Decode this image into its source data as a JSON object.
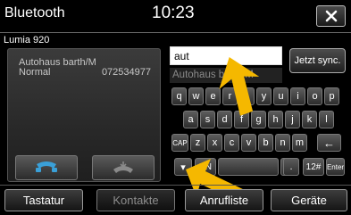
{
  "header": {
    "title": "Bluetooth",
    "time": "10:23",
    "close_icon": "close-icon"
  },
  "device": {
    "name": "Lumia 920"
  },
  "contact": {
    "name": "Autohaus barth/M",
    "type": "Normal",
    "number": "072534977"
  },
  "call_buttons": [
    {
      "icon": "phone-call-icon",
      "color": "#3aa0d8"
    },
    {
      "icon": "phone-hangup-icon",
      "color": "#8a8a8a"
    }
  ],
  "search": {
    "value": "aut"
  },
  "suggestion": {
    "text": "Autohaus barth/M"
  },
  "sync_button": {
    "label": "Jetzt sync."
  },
  "keyboard": {
    "row1": [
      "q",
      "w",
      "e",
      "r",
      "t",
      "y",
      "u",
      "i",
      "o",
      "p"
    ],
    "row2": [
      "a",
      "s",
      "d",
      "f",
      "g",
      "h",
      "j",
      "k",
      "l"
    ],
    "row3": [
      "CAP",
      "z",
      "x",
      "c",
      "v",
      "b",
      "n",
      "m",
      "←"
    ],
    "row4": [
      "▾",
      "EN",
      "",
      "",
      ".",
      "12#",
      "Enter"
    ]
  },
  "tabs": [
    {
      "label": "Tastatur",
      "active": false
    },
    {
      "label": "Kontakte",
      "active": true
    },
    {
      "label": "Anrufliste",
      "active": false
    },
    {
      "label": "Geräte",
      "active": false
    }
  ],
  "colors": {
    "arrow": "#f5b800",
    "call_accent": "#3aa0d8"
  }
}
